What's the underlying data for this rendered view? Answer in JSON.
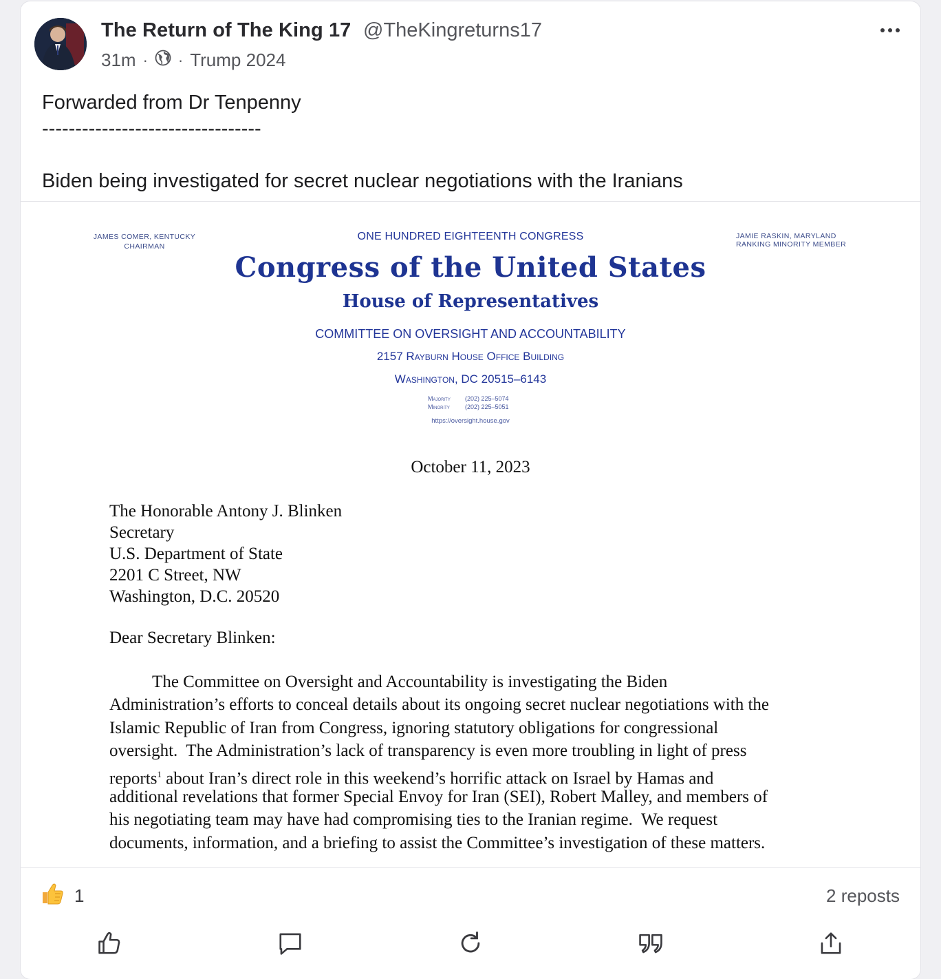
{
  "post": {
    "author_name": "The Return of The King 17",
    "author_handle": "@TheKingreturns17",
    "time": "31m",
    "separator": "·",
    "visibility_icon": "globe-icon",
    "group": "Trump 2024",
    "text_lines": [
      "Forwarded from Dr Tenpenny",
      "---------------------------------",
      "",
      "Biden being investigated for secret nuclear negotiations with the Iranians"
    ]
  },
  "letter": {
    "chairman_name": "JAMES COMER, KENTUCKY",
    "chairman_title": "CHAIRMAN",
    "ranking_name": "JAMIE RASKIN, MARYLAND",
    "ranking_title": "RANKING MINORITY MEMBER",
    "congress_number": "ONE HUNDRED EIGHTEENTH CONGRESS",
    "congress_title": "Congress of the United States",
    "house_title": "House of Representatives",
    "committee": "COMMITTEE ON OVERSIGHT AND ACCOUNTABILITY",
    "address_line1": "2157 Rayburn House Office Building",
    "address_line2": "Washington, DC 20515–6143",
    "majority_label": "Majority",
    "majority_phone": "(202) 225–5074",
    "minority_label": "Minority",
    "minority_phone": "(202) 225–5051",
    "url": "https://oversight.house.gov",
    "date": "October 11, 2023",
    "recipient": [
      "The Honorable Antony J. Blinken",
      "Secretary",
      "U.S. Department of State",
      "2201 C Street, NW",
      "Washington, D.C. 20520"
    ],
    "salutation": "Dear Secretary Blinken:",
    "body_lines": [
      "          The Committee on Oversight and Accountability is investigating the Biden",
      "Administration’s efforts to conceal details about its ongoing secret nuclear negotiations with the",
      "Islamic Republic of Iran from Congress, ignoring statutory obligations for congressional",
      "oversight.  The Administration’s lack of transparency is even more troubling in light of press",
      "about Iran’s direct role in this weekend’s horrific attack on Israel by Hamas and",
      "additional revelations that former Special Envoy for Iran (SEI), Robert Malley, and members of",
      "his negotiating team may have had compromising ties to the Iranian regime.  We request",
      "documents, information, and a briefing to assist the Committee’s investigation of these matters."
    ],
    "body_line5_lead": "reports",
    "footnote_mark": "1"
  },
  "engagement": {
    "reaction_icon": "thumbs-up-emoji",
    "reaction_count": "1",
    "reposts": "2 reposts"
  },
  "actions": [
    {
      "name": "like",
      "icon": "thumbs-up-icon"
    },
    {
      "name": "comment",
      "icon": "comment-icon"
    },
    {
      "name": "repost",
      "icon": "repost-icon"
    },
    {
      "name": "quote",
      "icon": "quote-icon"
    },
    {
      "name": "share",
      "icon": "share-icon"
    }
  ],
  "colors": {
    "letterhead_blue": "#23369a",
    "text_primary": "#1c1c1e",
    "text_secondary": "#55565b"
  }
}
